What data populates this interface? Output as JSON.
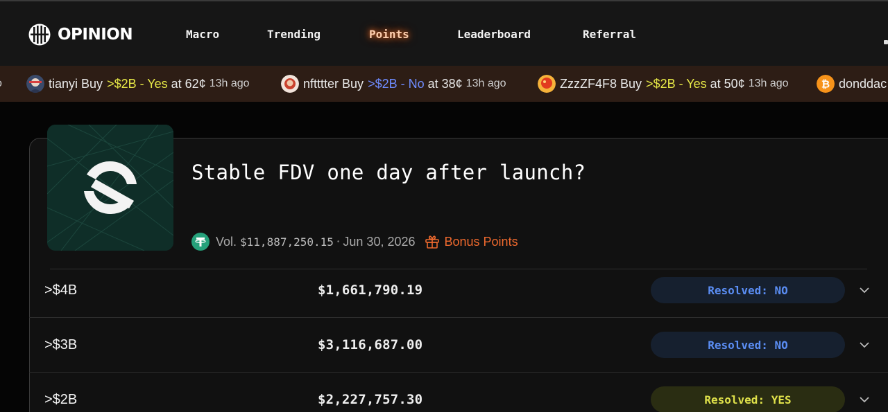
{
  "header": {
    "brand": "OPINION",
    "nav": [
      {
        "label": "Macro",
        "active": false
      },
      {
        "label": "Trending",
        "active": false
      },
      {
        "label": "Points",
        "active": true
      },
      {
        "label": "Leaderboard",
        "active": false
      },
      {
        "label": "Referral",
        "active": false
      }
    ]
  },
  "ticker": {
    "leading_fragment": "o",
    "items": [
      {
        "user": "tianyi",
        "action": "Buy",
        "market": ">$2B - Yes",
        "side": "yes",
        "at": "at",
        "price": "62¢",
        "time": "13h ago",
        "avatar_icon": "user-avatar-icon"
      },
      {
        "user": "nftttter",
        "action": "Buy",
        "market": ">$2B - No",
        "side": "no",
        "at": "at",
        "price": "38¢",
        "time": "13h ago",
        "avatar_icon": "user-avatar-icon"
      },
      {
        "user": "ZzzZF4F8",
        "action": "Buy",
        "market": ">$2B - Yes",
        "side": "yes",
        "at": "at",
        "price": "50¢",
        "time": "13h ago",
        "avatar_icon": "user-avatar-icon"
      },
      {
        "user": "donddac",
        "avatar_icon": "bitcoin-icon"
      }
    ]
  },
  "market": {
    "title": "Stable FDV one day after launch?",
    "vol_label": "Vol.",
    "vol_value": "$11,887,250.15",
    "date": "Jun 30, 2026",
    "bonus_label": "Bonus Points",
    "icon": "stable-logo-icon"
  },
  "outcomes": [
    {
      "label": ">$4B",
      "volume": "$1,661,790.19",
      "status": "Resolved: NO",
      "result": "no"
    },
    {
      "label": ">$3B",
      "volume": "$3,116,687.00",
      "status": "Resolved: NO",
      "result": "no"
    },
    {
      "label": ">$2B",
      "volume": "$2,227,757.30",
      "status": "Resolved: YES",
      "result": "yes"
    }
  ],
  "colors": {
    "accent_orange": "#f06a2e",
    "yes": "#e0e24a",
    "no": "#5b8ef5",
    "ticker_bg": "#2d1d15"
  }
}
